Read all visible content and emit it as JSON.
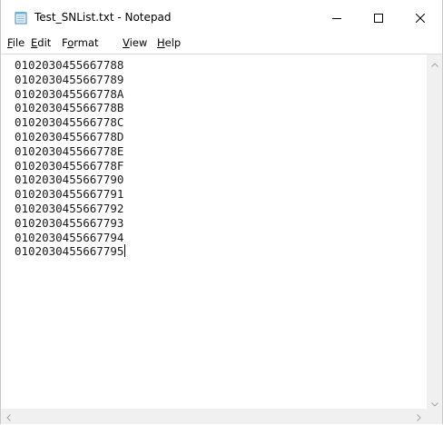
{
  "window": {
    "title": "Test_SNList.txt - Notepad"
  },
  "titlebar": {
    "icon": "notepad-icon",
    "minimize_icon": "minimize-icon",
    "maximize_icon": "maximize-icon",
    "close_icon": "close-icon"
  },
  "menubar": {
    "items": [
      {
        "mnemonic": "F",
        "rest": "ile"
      },
      {
        "mnemonic": "E",
        "rest": "dit"
      },
      {
        "pre": "F",
        "mnemonic": "o",
        "rest": "rmat"
      },
      {
        "mnemonic": "V",
        "rest": "iew"
      },
      {
        "mnemonic": "H",
        "rest": "elp"
      }
    ]
  },
  "editor": {
    "lines": [
      "0102030455667788",
      "0102030455667789",
      "010203045566778A",
      "010203045566778B",
      "010203045566778C",
      "010203045566778D",
      "010203045566778E",
      "010203045566778F",
      "0102030455667790",
      "0102030455667791",
      "0102030455667792",
      "0102030455667793",
      "0102030455667794",
      "0102030455667795"
    ]
  },
  "scrollbars": {
    "up_icon": "chevron-up-icon",
    "down_icon": "chevron-down-icon",
    "left_icon": "chevron-left-icon",
    "right_icon": "chevron-right-icon"
  }
}
